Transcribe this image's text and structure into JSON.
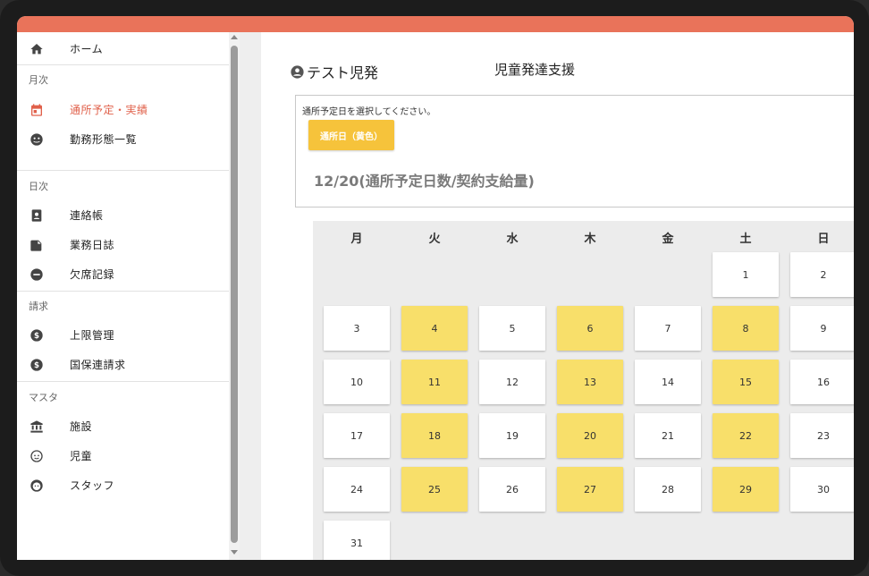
{
  "sidebar": {
    "home": "ホーム",
    "section_monthly": "月次",
    "attendance_plan": "通所予定・実績",
    "work_schedule": "勤務形態一覧",
    "section_daily": "日次",
    "contact_book": "連絡帳",
    "work_log": "業務日誌",
    "absence_record": "欠席記録",
    "section_billing": "請求",
    "limit_management": "上限管理",
    "kokuho_billing": "国保連請求",
    "section_master": "マスタ",
    "facility": "施設",
    "children": "児童",
    "staff": "スタッフ"
  },
  "header": {
    "child_name": "テスト児発",
    "service_name": "児童発達支援"
  },
  "selection": {
    "hint": "通所予定日を選択してください。",
    "legend_label": "通所日（黄色）",
    "count_text": "12/20(通所予定日数/契約支給量)"
  },
  "calendar": {
    "weekdays": [
      "月",
      "火",
      "水",
      "木",
      "金",
      "土",
      "日"
    ],
    "days": [
      "1",
      "2",
      "3",
      "4",
      "5",
      "6",
      "7",
      "8",
      "9",
      "10",
      "11",
      "12",
      "13",
      "14",
      "15",
      "16",
      "17",
      "18",
      "19",
      "20",
      "21",
      "22",
      "23",
      "24",
      "25",
      "26",
      "27",
      "28",
      "29",
      "30",
      "31"
    ],
    "selected_days": [
      4,
      6,
      8,
      11,
      13,
      15,
      18,
      20,
      22,
      25,
      27,
      29
    ]
  },
  "colors": {
    "accent": "#e9735a",
    "active_text": "#e0604a",
    "legend": "#f6c33b",
    "selected_day": "#f8df6a"
  }
}
